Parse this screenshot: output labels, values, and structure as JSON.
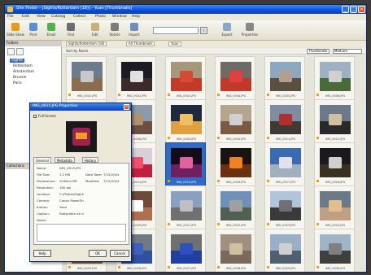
{
  "window": {
    "title": "Site Finder - [Sights/Rotterdam (18)] - Yuan [Thumbnails]",
    "min": "_",
    "max": "□",
    "close": "×"
  },
  "menu": [
    "File",
    "Edit",
    "View",
    "Catalog",
    "Collect",
    "Photo",
    "Window",
    "Help"
  ],
  "toolbar": {
    "buttons": [
      {
        "label": "Slide Show",
        "icon": "slideshow-icon",
        "color": "#e79b1a"
      },
      {
        "label": "Print",
        "icon": "printer-icon",
        "color": "#5a8fd6"
      },
      {
        "label": "Email",
        "icon": "envelope-icon",
        "color": "#4fb24f"
      },
      {
        "label": "Find",
        "icon": "binoculars-icon",
        "color": "#6d6d6d"
      },
      {
        "label": "Edit",
        "icon": "pencil-icon",
        "color": "#c9b07a"
      },
      {
        "label": "Rotate",
        "icon": "rotate-icon",
        "color": "#7b7b7b"
      },
      {
        "label": "Import",
        "icon": "import-icon",
        "color": "#6e8fb8"
      },
      {
        "label": "Export",
        "icon": "export-icon",
        "color": "#8aa7c8"
      },
      {
        "label": "Properties",
        "icon": "properties-icon",
        "color": "#888888"
      }
    ],
    "search_placeholder": "",
    "search_go": "›"
  },
  "sidebar": {
    "header": "Folders",
    "tree": [
      "Sights",
      "Rotterdam",
      "Amsterdam",
      "Brussel",
      "Paris"
    ],
    "selected_index": 0,
    "lower_header": "Collections"
  },
  "main": {
    "tabs": [
      "Sights/Rotterdam (18)",
      "All Thumbnails",
      "Yuan"
    ],
    "list_header": {
      "sort": "Sort by Name",
      "view": "Thumbnails",
      "size": "Medium"
    },
    "thumbs": [
      {
        "cap": "IMG_0001.JPG",
        "a": "#6b7c8c",
        "b": "#8a6d4e",
        "c": "#c8c8c8"
      },
      {
        "cap": "IMG_0002.JPG",
        "a": "#1c1a22",
        "b": "#3a2a2a",
        "c": "#e0e0e0"
      },
      {
        "cap": "IMG_0003.JPG",
        "a": "#a5987a",
        "b": "#c23a2a",
        "c": "#d94a35"
      },
      {
        "cap": "IMG_0004.JPG",
        "a": "#6e6a66",
        "b": "#c0392b",
        "c": "#e04040"
      },
      {
        "cap": "IMG_0005.JPG",
        "a": "#8ca8c0",
        "b": "#5a5040",
        "c": "#b0a090"
      },
      {
        "cap": "IMG_0006.JPG",
        "a": "#9fb0c2",
        "b": "#4a6a3a",
        "c": "#d0d0d0"
      },
      {
        "cap": "IMG_0007.JPG",
        "a": "#7f95a8",
        "b": "#5e4a3a",
        "c": "#3a3a3a"
      },
      {
        "cap": "IMG_0008.JPG",
        "a": "#8a9aa8",
        "b": "#6a5040",
        "c": "#b09070"
      },
      {
        "cap": "IMG_0009.JPG",
        "a": "#1e2a3e",
        "b": "#e0a040",
        "c": "#f0c060"
      },
      {
        "cap": "IMG_0010.JPG",
        "a": "#b6a58e",
        "b": "#7a5a40",
        "c": "#d0d0d0"
      },
      {
        "cap": "IMG_0011.JPG",
        "a": "#7e8da0",
        "b": "#403a36",
        "c": "#b03030"
      },
      {
        "cap": "IMG_0012.JPG",
        "a": "#6a7a8a",
        "b": "#2a2a2a",
        "c": "#d0c0a0"
      },
      {
        "cap": "IMG_0013.JPG",
        "a": "#1a1a1a",
        "b": "#802030",
        "c": "#e04080"
      },
      {
        "cap": "IMG_0014.JPG",
        "a": "#d8d0d8",
        "b": "#c02040",
        "c": "#f05070"
      },
      {
        "cap": "IMG_0015.JPG",
        "a": "#140c18",
        "b": "#702060",
        "c": "#e060a0"
      },
      {
        "cap": "IMG_0016.JPG",
        "a": "#1a1410",
        "b": "#6a3010",
        "c": "#f08020"
      },
      {
        "cap": "IMG_0017.JPG",
        "a": "#3a6ab0",
        "b": "#a0b0c0",
        "c": "#e0e0f0"
      },
      {
        "cap": "IMG_0018.JPG",
        "a": "#1a1a1e",
        "b": "#3a3020",
        "c": "#d0d0d0"
      },
      {
        "cap": "IMG_0019.JPG",
        "a": "#4a5a70",
        "b": "#2a2e36",
        "c": "#9a9a9a"
      },
      {
        "cap": "IMG_0020.JPG",
        "a": "#6e4a3a",
        "b": "#b07050",
        "c": "#ffffff"
      },
      {
        "cap": "IMG_0021.JPG",
        "a": "#8aa0c0",
        "b": "#707070",
        "c": "#c0c0c0"
      },
      {
        "cap": "IMG_0022.JPG",
        "a": "#7090b8",
        "b": "#506050",
        "c": "#a0a0a0"
      },
      {
        "cap": "IMG_0023.JPG",
        "a": "#b0c4dc",
        "b": "#3a3a3a",
        "c": "#707070"
      },
      {
        "cap": "IMG_0024.JPG",
        "a": "#6a7a86",
        "b": "#c0a080",
        "c": "#e0c090"
      },
      {
        "cap": "IMG_0025.JPG",
        "a": "#8a8070",
        "b": "#a06040",
        "c": "#c0a080"
      },
      {
        "cap": "IMG_0026.JPG",
        "a": "#707a84",
        "b": "#3050a0",
        "c": "#4060c0"
      },
      {
        "cap": "IMG_0027.JPG",
        "a": "#707070",
        "b": "#2040a0",
        "c": "#3050c0"
      },
      {
        "cap": "IMG_0028.JPG",
        "a": "#a09080",
        "b": "#7a6a5a",
        "c": "#d0c0a0"
      },
      {
        "cap": "IMG_0029.JPG",
        "a": "#9ab0c8",
        "b": "#506070",
        "c": "#d0d0d0"
      },
      {
        "cap": "IMG_0030.JPG",
        "a": "#a0b4c8",
        "b": "#404040",
        "c": "#808080"
      }
    ]
  },
  "dialog": {
    "title": "IMG_0015.JPG Properties",
    "close": "×",
    "checkbox_label": "Full-Screen",
    "tabs": [
      "General",
      "Metadata",
      "History"
    ],
    "rows": [
      {
        "k": "Name:",
        "v": "IMG_0015.JPG",
        "k2": "",
        "v2": ""
      },
      {
        "k": "File Size:",
        "v": "1.2 MB",
        "k2": "Date Taken:",
        "v2": "7/15/2004"
      },
      {
        "k": "Dimensions:",
        "v": "2048x1536",
        "k2": "Modified:",
        "v2": "7/15/2004"
      },
      {
        "k": "Resolution:",
        "v": "180 dpi",
        "k2": "",
        "v2": ""
      },
      {
        "k": "Location:",
        "v": "C:\\Photos\\Sights",
        "k2": "",
        "v2": ""
      },
      {
        "k": "Camera:",
        "v": "Canon PowerShot",
        "k2": "",
        "v2": ""
      },
      {
        "k": "Author:",
        "v": "Yuan",
        "k2": "",
        "v2": ""
      },
      {
        "k": "Caption:",
        "v": "Rotterdam at night",
        "k2": "",
        "v2": ""
      },
      {
        "k": "Notes:",
        "v": "",
        "k2": "",
        "v2": ""
      }
    ],
    "buttons": [
      "Help",
      "OK",
      "Cancel"
    ]
  }
}
